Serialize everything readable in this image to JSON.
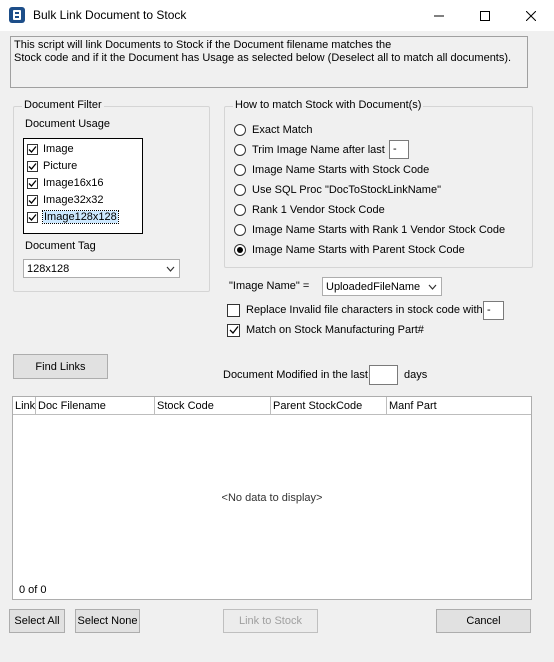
{
  "window": {
    "title": "Bulk Link Document to Stock"
  },
  "description": "This script will link Documents to Stock if the Document filename matches the\nStock code and if it the Document has Usage as selected below (Deselect all to match all documents).",
  "filter": {
    "group_label": "Document Filter",
    "usage_label": "Document Usage",
    "usage_items": [
      {
        "label": "Image",
        "checked": true
      },
      {
        "label": "Picture",
        "checked": true
      },
      {
        "label": "Image16x16",
        "checked": true
      },
      {
        "label": "Image32x32",
        "checked": true
      },
      {
        "label": "Image128x128",
        "checked": true
      }
    ],
    "tag_label": "Document Tag",
    "tag_value": "128x128"
  },
  "match": {
    "group_label": "How to match Stock with Document(s)",
    "options": [
      {
        "label": "Exact Match",
        "selected": false
      },
      {
        "label": "Trim Image Name after last",
        "selected": false
      },
      {
        "label": "Image Name Starts with Stock Code",
        "selected": false
      },
      {
        "label": "Use SQL Proc \"DocToStockLinkName\"",
        "selected": false
      },
      {
        "label": "Rank 1 Vendor Stock Code",
        "selected": false
      },
      {
        "label": "Image Name Starts with Rank 1 Vendor Stock Code",
        "selected": false
      },
      {
        "label": "Image Name Starts with Parent Stock Code",
        "selected": true
      }
    ],
    "trim_char": "-"
  },
  "image_name": {
    "label": "\"Image Name\" =",
    "value": "UploadedFileName"
  },
  "replace_invalid": {
    "label": "Replace Invalid file characters in stock code with",
    "checked": false,
    "value": "-"
  },
  "match_manf": {
    "label": "Match on Stock Manufacturing Part#",
    "checked": true
  },
  "find_links": "Find Links",
  "modified": {
    "prefix": "Document Modified in the last",
    "suffix": "days",
    "value": ""
  },
  "grid": {
    "columns": [
      "Link",
      "Doc Filename",
      "Stock Code",
      "Parent StockCode",
      "Manf Part"
    ],
    "empty_text": "<No data to display>",
    "count": "0 of 0"
  },
  "buttons": {
    "select_all": "Select All",
    "select_none": "Select None",
    "link_to_stock": "Link to Stock",
    "cancel": "Cancel"
  }
}
